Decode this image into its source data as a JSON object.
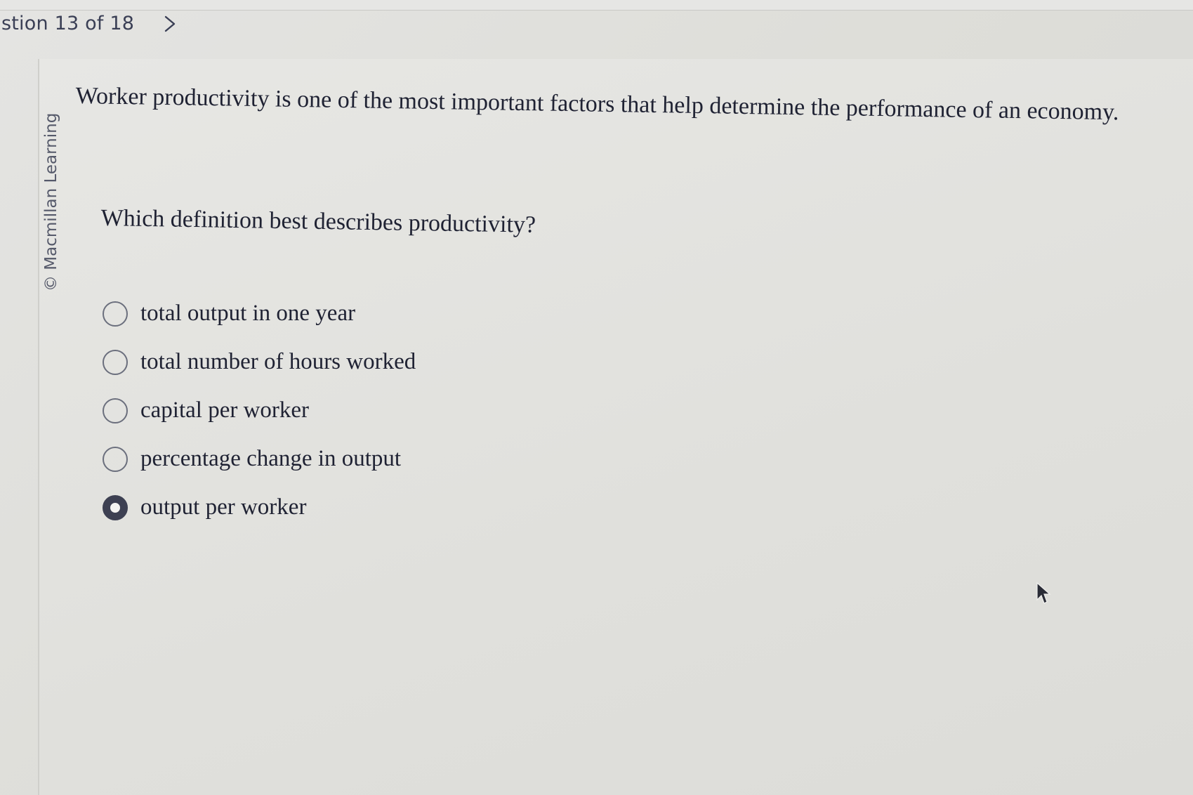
{
  "nav": {
    "question_counter": "stion 13 of 18",
    "next_icon": "chevron-right-icon"
  },
  "credit": {
    "text": "© Macmillan Learning"
  },
  "question": {
    "stem": "Worker productivity is one of the most important factors that help determine the performance of an economy.",
    "prompt": "Which definition best describes productivity?",
    "options": [
      {
        "label": "total output in one year",
        "selected": false
      },
      {
        "label": "total number of hours worked",
        "selected": false
      },
      {
        "label": "capital per worker",
        "selected": false
      },
      {
        "label": "percentage change in output",
        "selected": false
      },
      {
        "label": "output per worker",
        "selected": true
      }
    ]
  },
  "colors": {
    "text": "#1f2233",
    "radio_selected": "#3d4052",
    "radio_border": "#6b6f7d"
  }
}
